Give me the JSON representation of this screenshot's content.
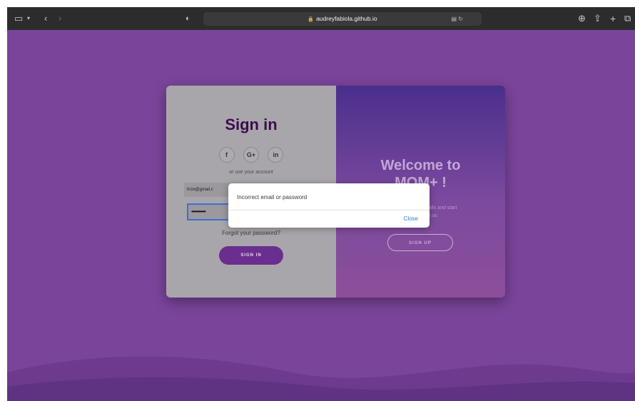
{
  "browser": {
    "url": "audreyfabiola.github.io"
  },
  "signin": {
    "title": "Sign in",
    "socials": [
      "f",
      "G+",
      "in"
    ],
    "use_account": "or use your account",
    "email_value": "hrze@gmail.c",
    "password_value": "•••••••••••",
    "forgot_link": "Forgot your password?",
    "signin_button": "SIGN IN"
  },
  "welcome": {
    "title_line1": "Welcome to",
    "title_line2": "MOM+ !",
    "subtitle_line1": "details and start",
    "subtitle_line2": "with us",
    "signup_button": "SIGN UP"
  },
  "alert": {
    "message": "Incorrect email or password",
    "close_label": "Close"
  },
  "colors": {
    "page_bg": "#7a449a",
    "accent": "#6a2f8e",
    "link": "#2b7bd8"
  }
}
